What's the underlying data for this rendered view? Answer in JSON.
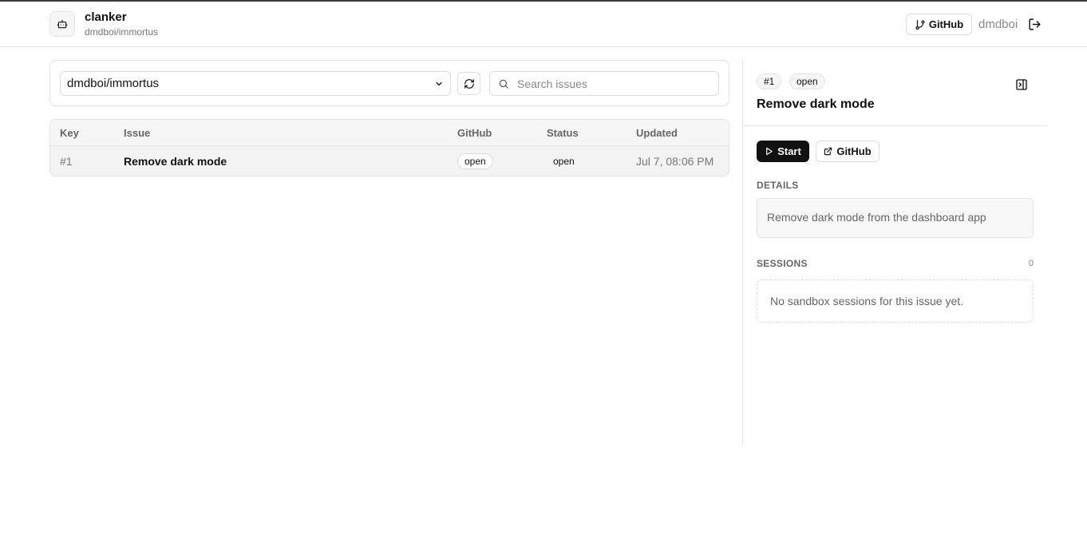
{
  "header": {
    "app_name": "clanker",
    "repo": "dmdboi/immortus",
    "github_label": "GitHub",
    "username": "dmdboi"
  },
  "filters": {
    "selected_repo": "dmdboi/immortus",
    "search_placeholder": "Search issues"
  },
  "table": {
    "columns": [
      "Key",
      "Issue",
      "GitHub",
      "Status",
      "Updated"
    ],
    "rows": [
      {
        "key": "#1",
        "issue": "Remove dark mode",
        "github": "open",
        "status": "open",
        "updated": "Jul 7, 08:06 PM"
      }
    ]
  },
  "detail": {
    "key": "#1",
    "state": "open",
    "title": "Remove dark mode",
    "start_label": "Start",
    "github_label": "GitHub",
    "details_heading": "DETAILS",
    "details_text": "Remove dark mode from the dashboard app",
    "sessions_heading": "SESSIONS",
    "sessions_count": "0",
    "sessions_empty": "No sandbox sessions for this issue yet."
  }
}
